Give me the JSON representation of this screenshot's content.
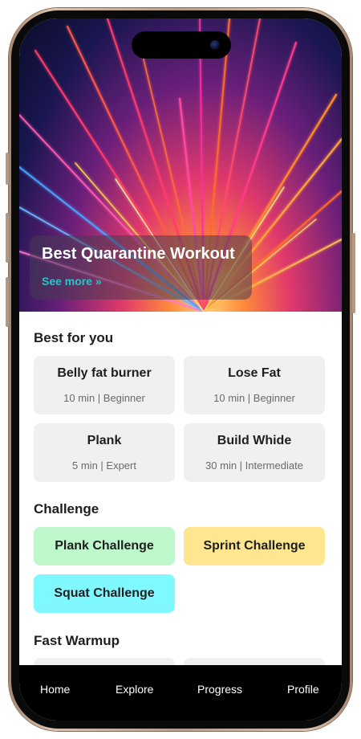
{
  "hero": {
    "title": "Best Quarantine Workout",
    "link": "See more »"
  },
  "sections": {
    "best_for_you": "Best for you",
    "challenge": "Challenge",
    "fast_warmup": "Fast Warmup"
  },
  "workouts": [
    {
      "title": "Belly fat burner",
      "meta": "10 min | Beginner"
    },
    {
      "title": "Lose Fat",
      "meta": "10 min | Beginner"
    },
    {
      "title": "Plank",
      "meta": "5 min | Expert"
    },
    {
      "title": "Build Whide",
      "meta": "30 min | Intermediate"
    }
  ],
  "challenges": [
    {
      "label": "Plank Challenge",
      "color": "#bff7cd"
    },
    {
      "label": "Sprint Challenge",
      "color": "#fde68f"
    },
    {
      "label": "Squat Challenge",
      "color": "#7ff9ff"
    }
  ],
  "tabbar": [
    "Home",
    "Explore",
    "Progress",
    "Profile"
  ]
}
